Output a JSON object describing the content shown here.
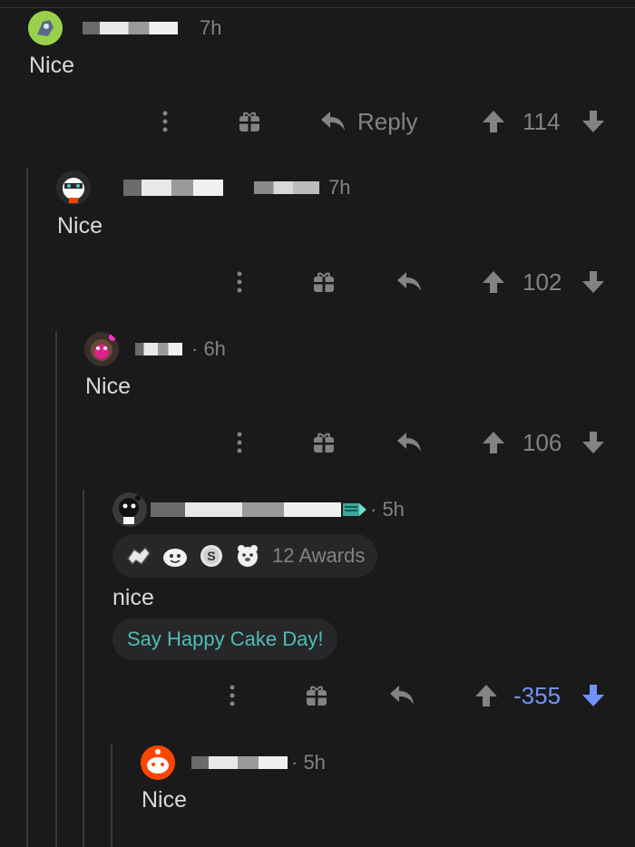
{
  "comments": [
    {
      "time": "7h",
      "body": "Nice",
      "score": "114",
      "reply_label": "Reply"
    },
    {
      "time": "7h",
      "body": "Nice",
      "score": "102"
    },
    {
      "time": "· 6h",
      "body": "Nice",
      "score": "106"
    },
    {
      "time": "· 5h",
      "body": "nice",
      "score": "-355",
      "awards_label": "12 Awards",
      "cake_day": "Say Happy Cake Day!",
      "vote_state": "downvoted"
    },
    {
      "time": "· 5h",
      "body": "Nice"
    }
  ],
  "colors": {
    "background": "#1a1a1b",
    "text": "#d7dadc",
    "muted": "#818384",
    "downvote": "#7193ff",
    "cake": "#4fbdba"
  }
}
